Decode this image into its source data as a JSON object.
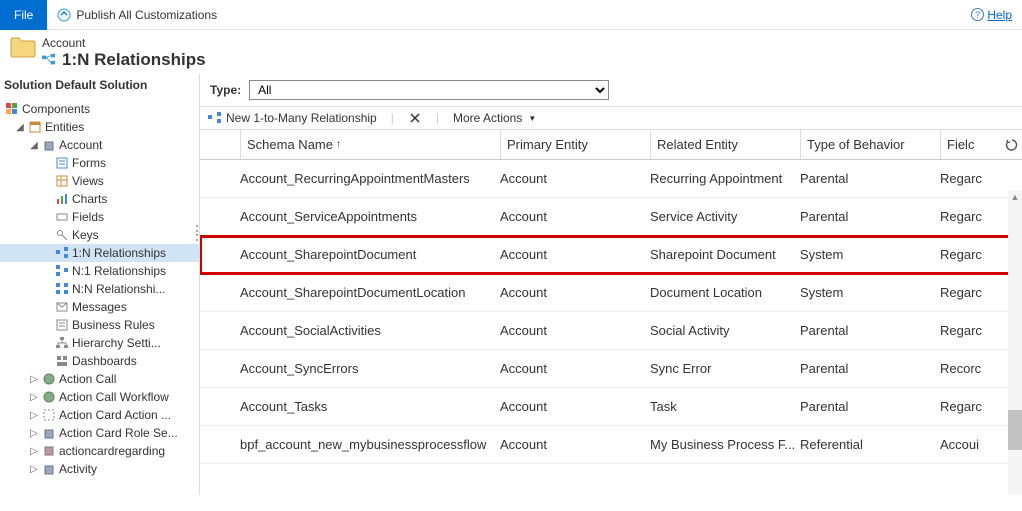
{
  "topbar": {
    "file_label": "File",
    "publish_label": "Publish All Customizations",
    "help_label": "Help"
  },
  "header": {
    "entity_label": "Account",
    "page_title": "1:N Relationships"
  },
  "sidebar": {
    "title": "Solution Default Solution",
    "nodes": {
      "components": "Components",
      "entities": "Entities",
      "account": "Account",
      "forms": "Forms",
      "views": "Views",
      "charts": "Charts",
      "fields": "Fields",
      "keys": "Keys",
      "rel_1n": "1:N Relationships",
      "rel_n1": "N:1 Relationships",
      "rel_nn": "N:N Relationshi...",
      "messages": "Messages",
      "business_rules": "Business Rules",
      "hierarchy": "Hierarchy Setti...",
      "dashboards": "Dashboards",
      "action_call": "Action Call",
      "action_call_workflow": "Action Call Workflow",
      "action_card_action": "Action Card Action ...",
      "action_card_role": "Action Card Role Se...",
      "actioncardregarding": "actioncardregarding",
      "activity": "Activity"
    }
  },
  "filter": {
    "label": "Type:",
    "value": "All"
  },
  "toolbar": {
    "new_label": "New 1-to-Many Relationship",
    "more_label": "More Actions"
  },
  "grid": {
    "columns": {
      "schema": "Schema Name",
      "primary": "Primary Entity",
      "related": "Related Entity",
      "behavior": "Type of Behavior",
      "field": "Fielc"
    },
    "rows": [
      {
        "schema": "Account_RecurringAppointmentMasters",
        "primary": "Account",
        "related": "Recurring Appointment",
        "behavior": "Parental",
        "field": "Regarc",
        "highlight": false
      },
      {
        "schema": "Account_ServiceAppointments",
        "primary": "Account",
        "related": "Service Activity",
        "behavior": "Parental",
        "field": "Regarc",
        "highlight": false
      },
      {
        "schema": "Account_SharepointDocument",
        "primary": "Account",
        "related": "Sharepoint Document",
        "behavior": "System",
        "field": "Regarc",
        "highlight": true
      },
      {
        "schema": "Account_SharepointDocumentLocation",
        "primary": "Account",
        "related": "Document Location",
        "behavior": "System",
        "field": "Regarc",
        "highlight": false
      },
      {
        "schema": "Account_SocialActivities",
        "primary": "Account",
        "related": "Social Activity",
        "behavior": "Parental",
        "field": "Regarc",
        "highlight": false
      },
      {
        "schema": "Account_SyncErrors",
        "primary": "Account",
        "related": "Sync Error",
        "behavior": "Parental",
        "field": "Recorc",
        "highlight": false
      },
      {
        "schema": "Account_Tasks",
        "primary": "Account",
        "related": "Task",
        "behavior": "Parental",
        "field": "Regarc",
        "highlight": false
      },
      {
        "schema": "bpf_account_new_mybusinessprocessflow",
        "primary": "Account",
        "related": "My Business Process F...",
        "behavior": "Referential",
        "field": "Accoui",
        "highlight": false
      }
    ]
  }
}
